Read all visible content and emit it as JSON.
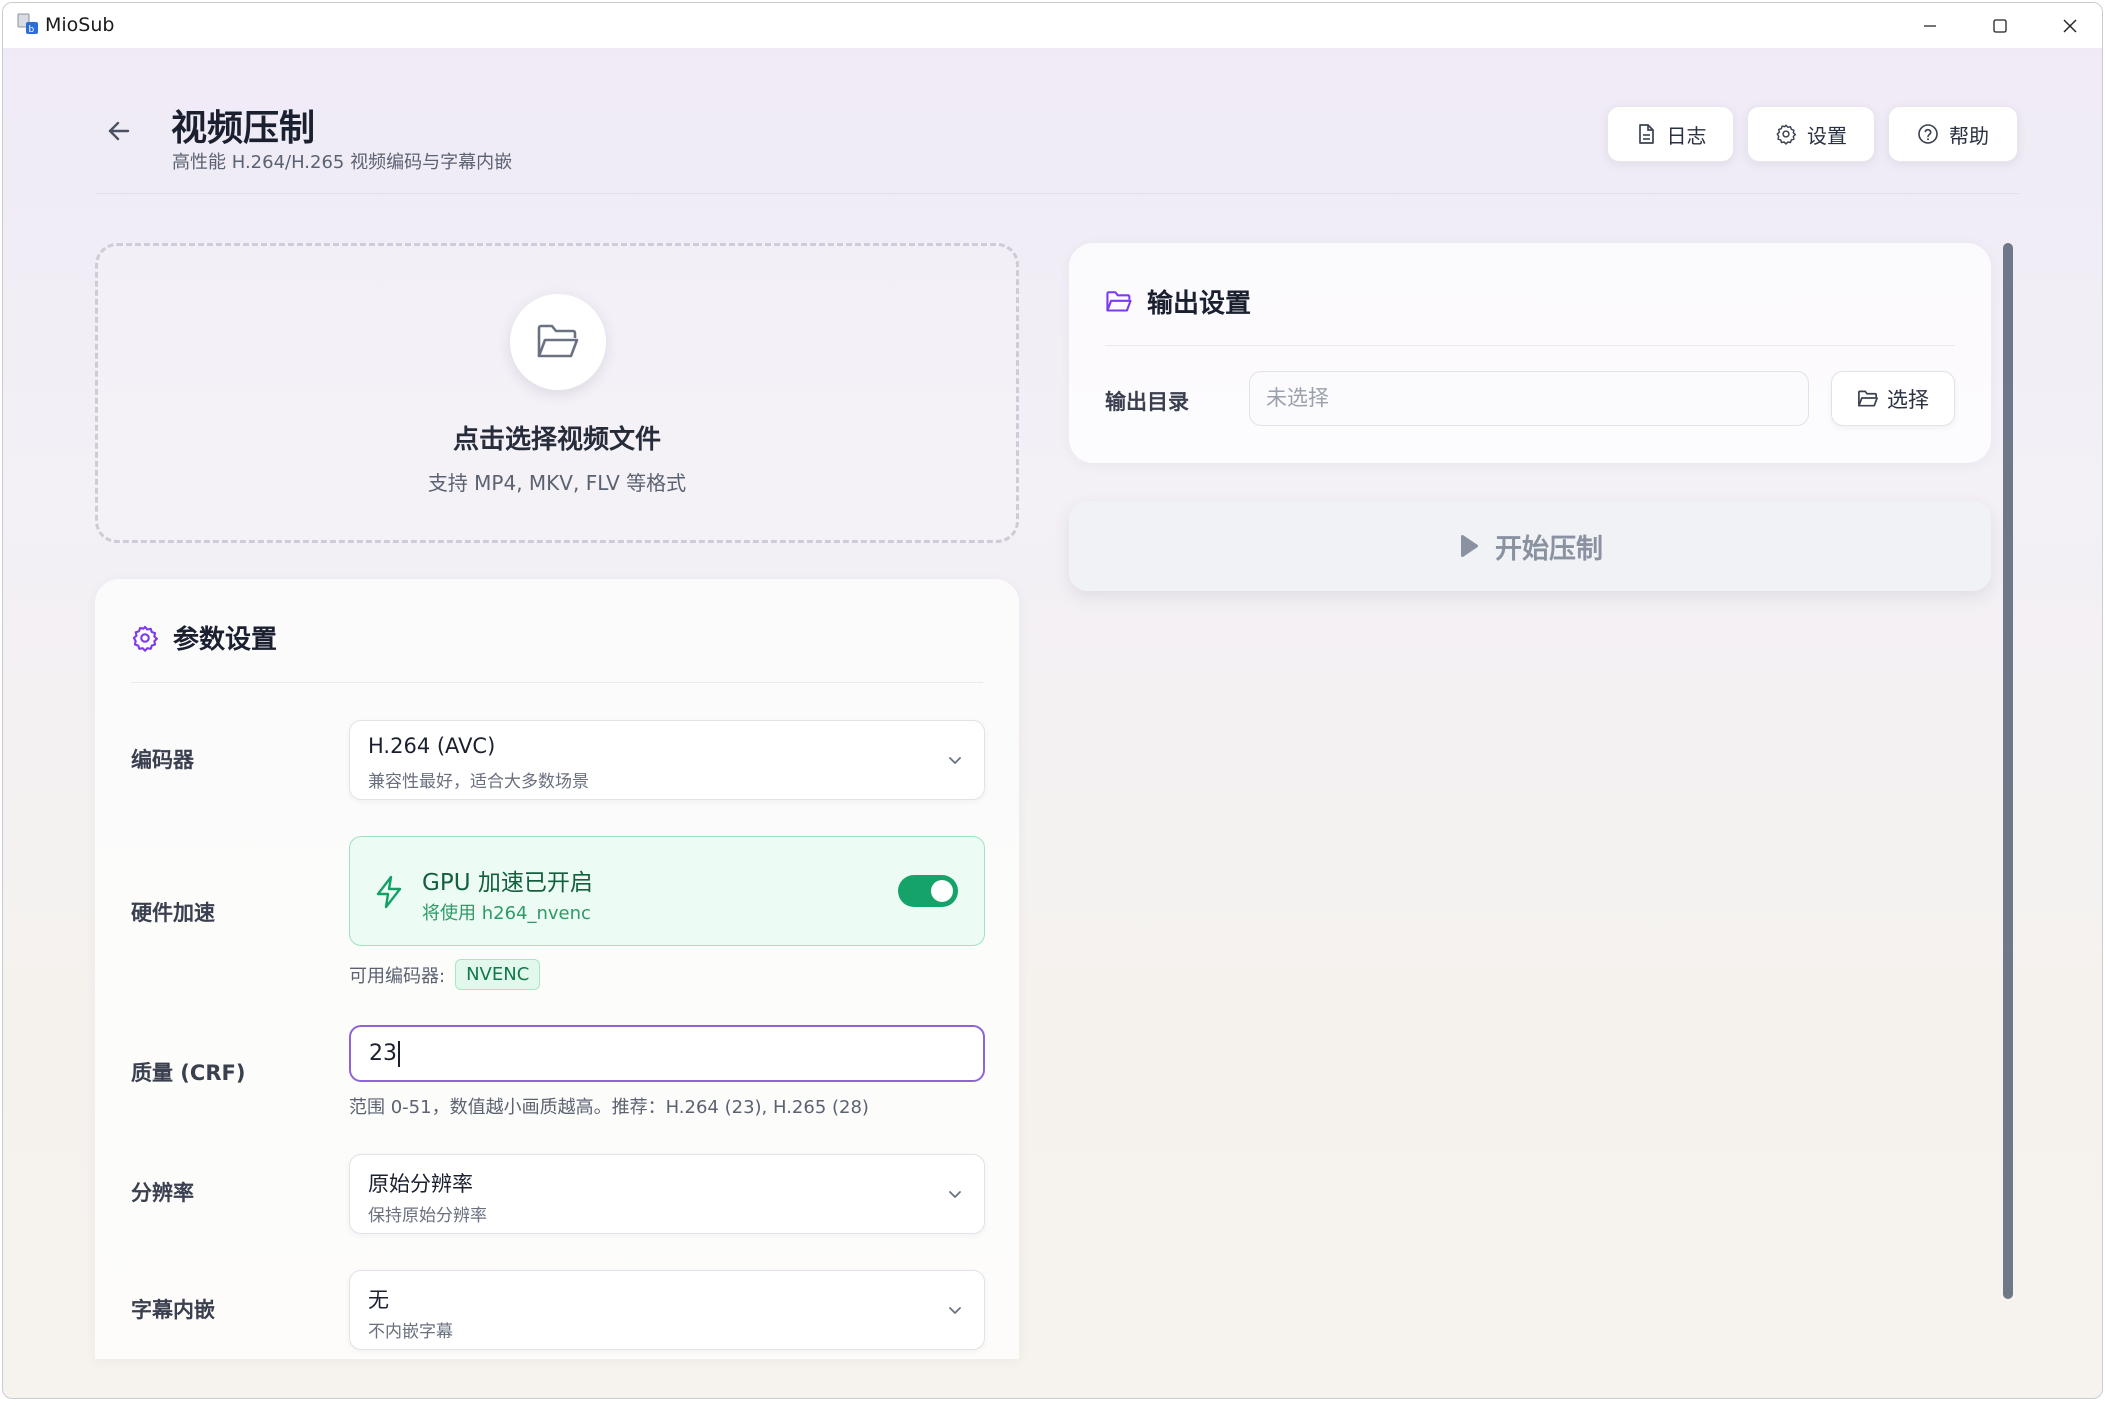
{
  "window": {
    "title": "MioSub"
  },
  "header": {
    "title": "视频压制",
    "subtitle": "高性能 H.264/H.265 视频编码与字幕内嵌",
    "buttons": {
      "log": "日志",
      "settings": "设置",
      "help": "帮助"
    }
  },
  "dropzone": {
    "title": "点击选择视频文件",
    "subtitle": "支持 MP4, MKV, FLV 等格式"
  },
  "params": {
    "title": "参数设置",
    "encoder": {
      "label": "编码器",
      "value": "H.264 (AVC)",
      "description": "兼容性最好，适合大多数场景"
    },
    "hardware": {
      "label": "硬件加速",
      "status_title": "GPU 加速已开启",
      "status_sub": "将使用 h264_nvenc",
      "enabled": true,
      "available_label": "可用编码器:",
      "available_badge": "NVENC"
    },
    "quality": {
      "label": "质量 (CRF)",
      "value": "23",
      "hint": "范围 0-51，数值越小画质越高。推荐：H.264 (23), H.265 (28)"
    },
    "resolution": {
      "label": "分辨率",
      "value": "原始分辨率",
      "description": "保持原始分辨率"
    },
    "subtitle": {
      "label": "字幕内嵌",
      "value": "无",
      "description": "不内嵌字幕"
    }
  },
  "output": {
    "title": "输出设置",
    "dir_label": "输出目录",
    "dir_placeholder": "未选择",
    "choose_button": "选择"
  },
  "start_button": "开始压制",
  "colors": {
    "accent": "#8e64d8",
    "success": "#16a36a",
    "title_icon": "#7c3aed"
  }
}
